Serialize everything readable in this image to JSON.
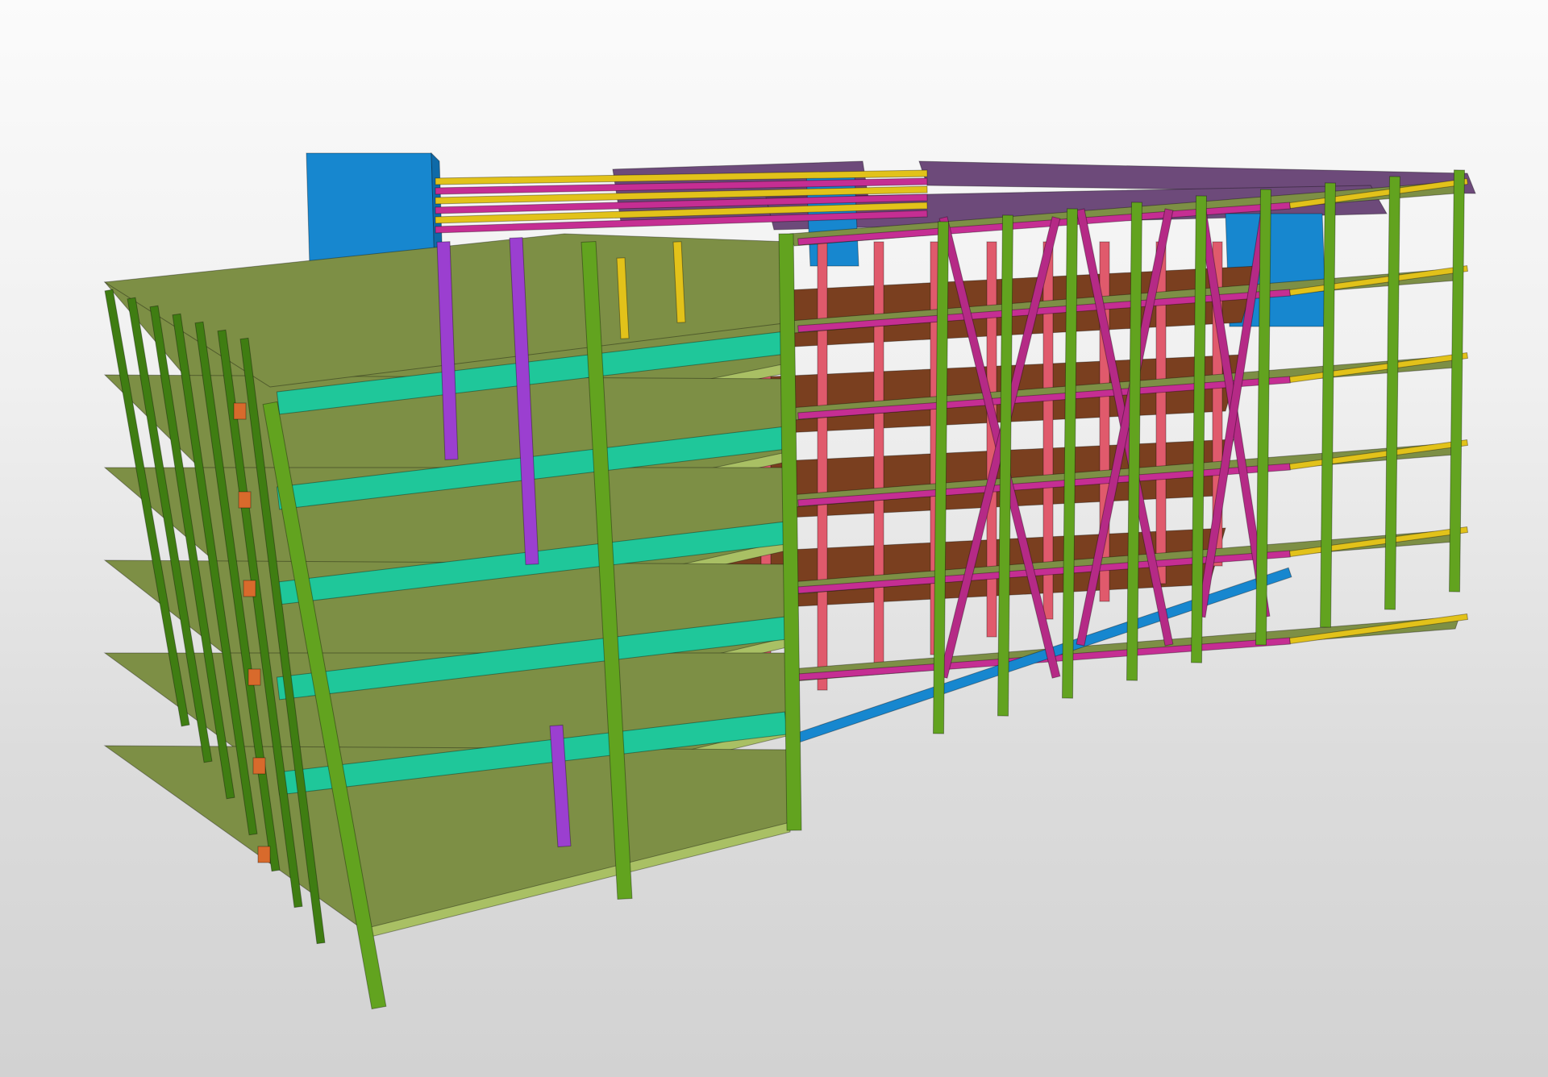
{
  "viewport": {
    "type": "3d-bim-structural-model",
    "view": "perspective-shaded",
    "background": [
      "#fbfbfb",
      "#d2d2d2"
    ]
  },
  "legend_colors": {
    "slab": "#7d8f45",
    "slab_edge": "#a9c064",
    "interior_slab": "#7a3f1f",
    "column": "#62a31f",
    "column_dark": "#3f7d12",
    "beam_teal": "#1fc79a",
    "beam_magenta": "#c52e93",
    "bracing": "#b52a86",
    "column_pink": "#e05a6c",
    "column_purple": "#9b3fd0",
    "core_blue": "#1787cf",
    "roof_purple": "#6d4a7a",
    "beam_yellow": "#e2c21a",
    "connector_orange": "#d86a2c"
  },
  "icons": []
}
